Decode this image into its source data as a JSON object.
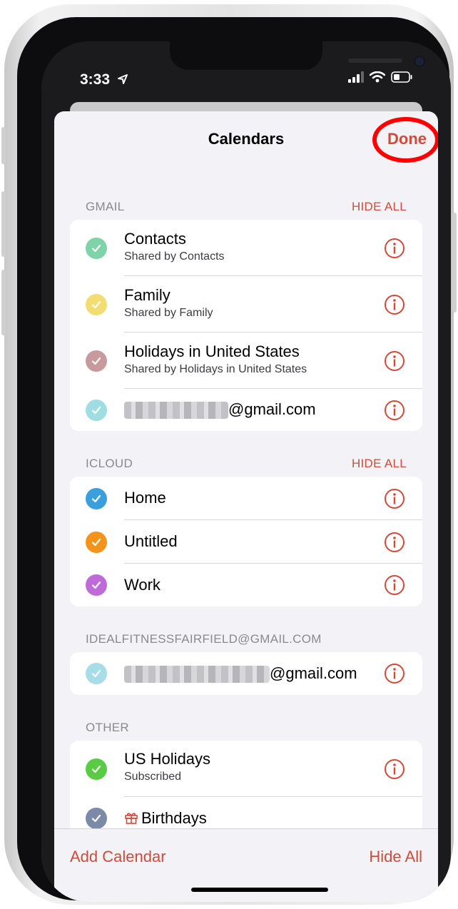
{
  "status": {
    "time": "3:33"
  },
  "header": {
    "title": "Calendars",
    "done_label": "Done"
  },
  "sections": [
    {
      "name": "GMAIL",
      "hide_all": "HIDE ALL"
    },
    {
      "name": "ICLOUD",
      "hide_all": "HIDE ALL"
    },
    {
      "name": "IDEALFITNESSFAIRFIELD@GMAIL.COM"
    },
    {
      "name": "OTHER"
    }
  ],
  "gmail": [
    {
      "title": "Contacts",
      "subtitle": "Shared by Contacts",
      "color": "#7fd3a9"
    },
    {
      "title": "Family",
      "subtitle": "Shared by Family",
      "color": "#f2dd73"
    },
    {
      "title": "Holidays in United States",
      "subtitle": "Shared by Holidays in United States",
      "color": "#c89a9e"
    },
    {
      "title": "@gmail.com",
      "color": "#9fdde2"
    }
  ],
  "icloud": [
    {
      "title": "Home",
      "color": "#3a9fdc"
    },
    {
      "title": "Untitled",
      "color": "#f2941b"
    },
    {
      "title": "Work",
      "color": "#bf6ad8"
    }
  ],
  "fitness": [
    {
      "title": "@gmail.com",
      "color": "#a7dde7"
    }
  ],
  "other": [
    {
      "title": "US Holidays",
      "subtitle": "Subscribed",
      "color": "#5acb45"
    },
    {
      "title": "Birthdays",
      "color": "#7b8aa8"
    }
  ],
  "footer": {
    "add_calendar": "Add Calendar",
    "hide_all": "Hide All"
  },
  "accent_color": "#d14a3a"
}
